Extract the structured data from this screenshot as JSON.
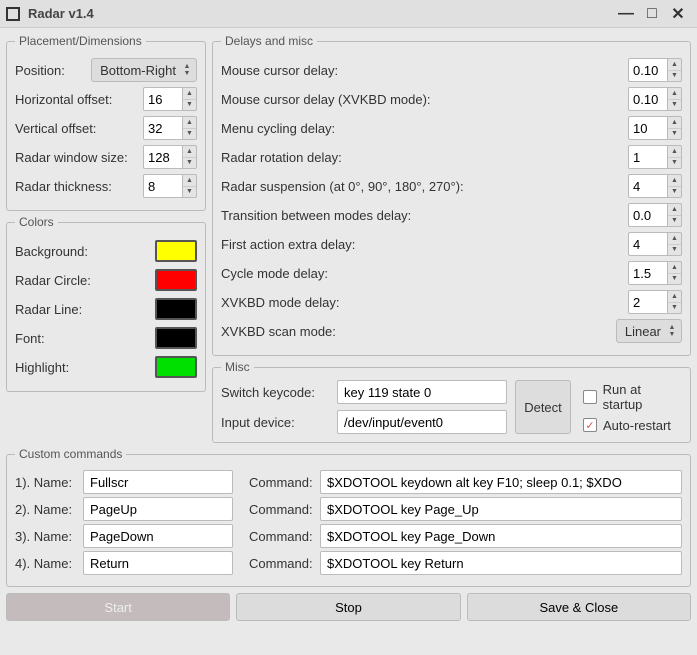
{
  "title": "Radar v1.4",
  "placement": {
    "legend": "Placement/Dimensions",
    "position_label": "Position:",
    "position_value": "Bottom-Right",
    "h_offset_label": "Horizontal offset:",
    "h_offset_value": "16",
    "v_offset_label": "Vertical offset:",
    "v_offset_value": "32",
    "win_size_label": "Radar window size:",
    "win_size_value": "128",
    "thickness_label": "Radar thickness:",
    "thickness_value": "8"
  },
  "colors": {
    "legend": "Colors",
    "background_label": "Background:",
    "background_value": "#ffff00",
    "circle_label": "Radar Circle:",
    "circle_value": "#ff0000",
    "line_label": "Radar Line:",
    "line_value": "#000000",
    "font_label": "Font:",
    "font_value": "#000000",
    "highlight_label": "Highlight:",
    "highlight_value": "#00e000"
  },
  "delays": {
    "legend": "Delays and misc",
    "mouse_delay_label": "Mouse cursor delay:",
    "mouse_delay_value": "0.10",
    "mouse_xvkbd_label": "Mouse cursor delay (XVKBD mode):",
    "mouse_xvkbd_value": "0.10",
    "menu_cycle_label": "Menu cycling delay:",
    "menu_cycle_value": "10",
    "rotation_label": "Radar rotation delay:",
    "rotation_value": "1",
    "suspension_label": "Radar suspension (at 0°, 90°, 180°, 270°):",
    "suspension_value": "4",
    "transition_label": "Transition between modes delay:",
    "transition_value": "0.0",
    "first_action_label": "First action extra delay:",
    "first_action_value": "4",
    "cycle_mode_label": "Cycle mode delay:",
    "cycle_mode_value": "1.5",
    "xvkbd_mode_label": "XVKBD mode delay:",
    "xvkbd_mode_value": "2",
    "scan_mode_label": "XVKBD scan mode:",
    "scan_mode_value": "Linear"
  },
  "misc": {
    "legend": "Misc",
    "switch_keycode_label": "Switch keycode:",
    "switch_keycode_value": "key 119 state 0",
    "input_device_label": "Input device:",
    "input_device_value": "/dev/input/event0",
    "detect_label": "Detect",
    "run_startup_label": "Run at startup",
    "run_startup_checked": false,
    "auto_restart_label": "Auto-restart",
    "auto_restart_checked": true
  },
  "commands": {
    "legend": "Custom commands",
    "name_label": "Name:",
    "command_label": "Command:",
    "rows": [
      {
        "idx": "1).",
        "name": "Fullscr",
        "cmd": "$XDOTOOL keydown alt key F10; sleep 0.1; $XDO"
      },
      {
        "idx": "2).",
        "name": "PageUp",
        "cmd": "$XDOTOOL key Page_Up"
      },
      {
        "idx": "3).",
        "name": "PageDown",
        "cmd": "$XDOTOOL key Page_Down"
      },
      {
        "idx": "4).",
        "name": "Return",
        "cmd": "$XDOTOOL key Return"
      }
    ]
  },
  "buttons": {
    "start": "Start",
    "stop": "Stop",
    "save_close": "Save & Close"
  }
}
